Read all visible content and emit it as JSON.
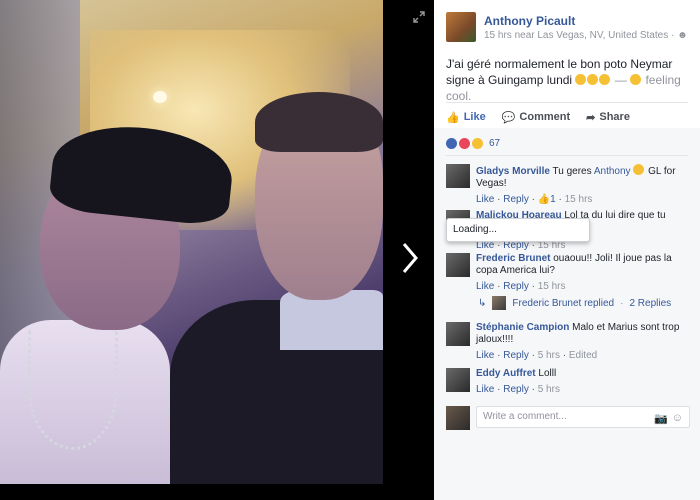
{
  "post": {
    "author": "Anthony Picault",
    "meta": "15 hrs near Las Vegas, NV, United States · ",
    "text": "J'ai géré normalement le bon poto Neymar signe à Guingamp lundi",
    "feeling_text": " — ",
    "feeling": "feeling cool."
  },
  "actions": {
    "like": "Like",
    "comment": "Comment",
    "share": "Share"
  },
  "reactions": {
    "count": "67"
  },
  "tooltip": {
    "text": "Loading..."
  },
  "comments": [
    {
      "name": "Gladys Morville",
      "text": "Tu geres",
      "mention": "Anthony",
      "text_after": " GL for Vegas!",
      "like": "Like",
      "reply": "Reply",
      "likes": "1",
      "time": "15 hrs"
    },
    {
      "name": "Malickou Hoareau",
      "text": "Lol ta du lui dire que tu voulais",
      "like": "Like",
      "reply": "Reply",
      "time": "15 hrs"
    },
    {
      "name": "Frederic Brunet",
      "text": "ouaouu!! Joli! Il joue pas la copa America lui?",
      "like": "Like",
      "reply": "Reply",
      "time": "15 hrs"
    },
    {
      "name": "Stéphanie Campion",
      "text": "Malo et Marius sont trop jaloux!!!!",
      "like": "Like",
      "reply": "Reply",
      "time": "5 hrs",
      "edited": "Edited"
    },
    {
      "name": "Eddy Auffret",
      "text": "Lolll",
      "like": "Like",
      "reply": "Reply",
      "time": "5 hrs"
    }
  ],
  "replies": {
    "name": "Frederic Brunet replied",
    "count": "2 Replies"
  },
  "write": {
    "placeholder": "Write a comment..."
  }
}
